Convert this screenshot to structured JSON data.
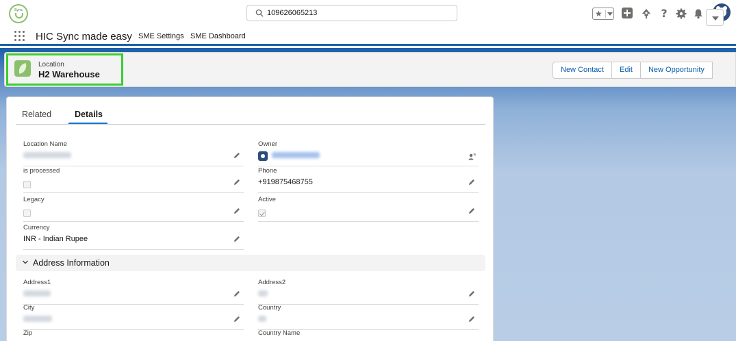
{
  "header": {
    "search_value": "109626065213",
    "logo_text": "Sync"
  },
  "nav": {
    "app_name": "HIC Sync made easy",
    "tabs": [
      "SME Settings",
      "SME Dashboard"
    ]
  },
  "record": {
    "object_label": "Location",
    "title": "H2 Warehouse",
    "actions": [
      "New Contact",
      "Edit",
      "New Opportunity"
    ]
  },
  "tabs": {
    "related": "Related",
    "details": "Details"
  },
  "fields": {
    "location_name": {
      "label": "Location Name",
      "value": ""
    },
    "owner": {
      "label": "Owner",
      "value": ""
    },
    "is_processed": {
      "label": "is processed",
      "checked": false
    },
    "phone": {
      "label": "Phone",
      "value": "+919875468755"
    },
    "legacy": {
      "label": "Legacy",
      "checked": false
    },
    "active": {
      "label": "Active",
      "checked": true
    },
    "currency": {
      "label": "Currency",
      "value": "INR - Indian Rupee"
    },
    "address1": {
      "label": "Address1",
      "value": ""
    },
    "address2": {
      "label": "Address2",
      "value": ""
    },
    "city": {
      "label": "City",
      "value": ""
    },
    "country": {
      "label": "Country",
      "value": ""
    },
    "zip": {
      "label": "Zip",
      "value": ""
    },
    "country_name": {
      "label": "Country Name",
      "value": ""
    }
  },
  "sections": {
    "address": "Address Information"
  },
  "colors": {
    "brand_blue": "#1b5fa8",
    "highlight": "#3ccc30",
    "link": "#0b5cab",
    "record_icon": "#8ac06b"
  },
  "icons": [
    "search-icon",
    "star-icon",
    "add-icon",
    "trailhead-icon",
    "help-icon",
    "settings-icon",
    "notifications-icon",
    "app-launcher-icon",
    "edit-pencil-icon",
    "change-owner-icon",
    "chevron-down-icon"
  ]
}
